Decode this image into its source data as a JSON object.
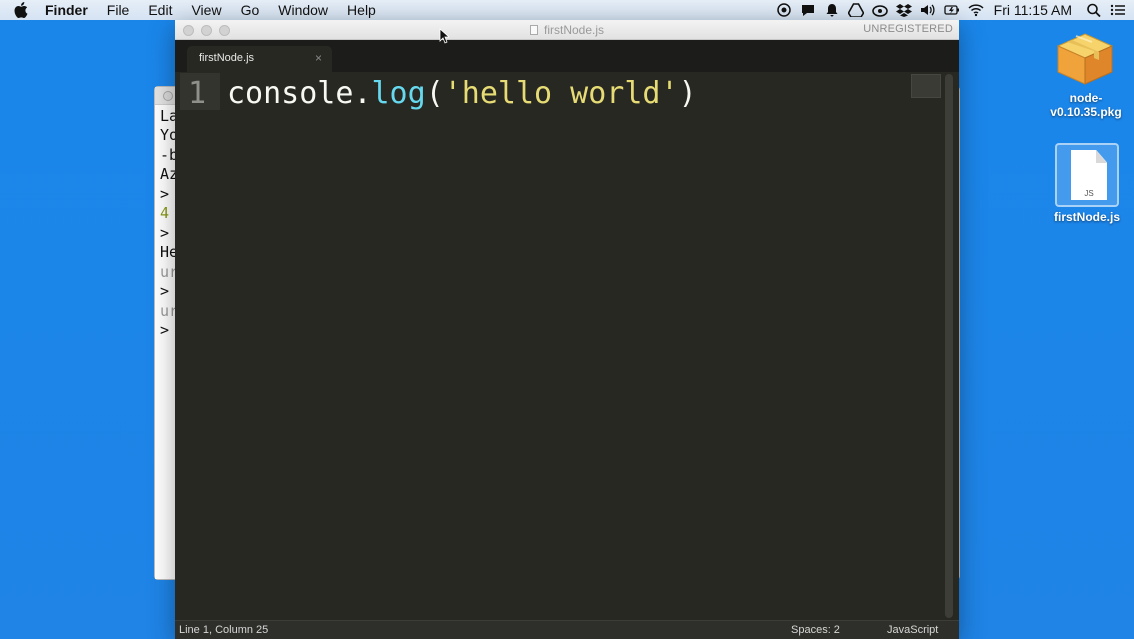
{
  "menubar": {
    "app_name": "Finder",
    "items": [
      "File",
      "Edit",
      "View",
      "Go",
      "Window",
      "Help"
    ],
    "clock": "Fri 11:15 AM"
  },
  "terminal": {
    "lines": [
      "La",
      "Yo",
      "-b",
      "Az",
      ">",
      "4",
      ">",
      "He",
      "ur",
      ">",
      "ur",
      ">"
    ]
  },
  "editor_window": {
    "title": "firstNode.js",
    "license_status": "UNREGISTERED",
    "tab_label": "firstNode.js",
    "tab_close": "×",
    "line_number": "1",
    "code": {
      "part1": "console",
      "part2": ".",
      "part3": "log",
      "part4": "(",
      "part5": "'hello world'",
      "part6": ")"
    },
    "status": {
      "position": "Line 1, Column 25",
      "indentation": "Spaces: 2",
      "syntax": "JavaScript"
    }
  },
  "desktop": {
    "pkg_label_line1": "node-",
    "pkg_label_line2": "v0.10.35.pkg",
    "js_file_label": "firstNode.js",
    "js_file_badge": "JS"
  },
  "colors": {
    "desktop_bg": "#1f84e6",
    "editor_bg": "#272822",
    "keyword_blue": "#66d9ef",
    "string_yellow": "#e6db74"
  }
}
